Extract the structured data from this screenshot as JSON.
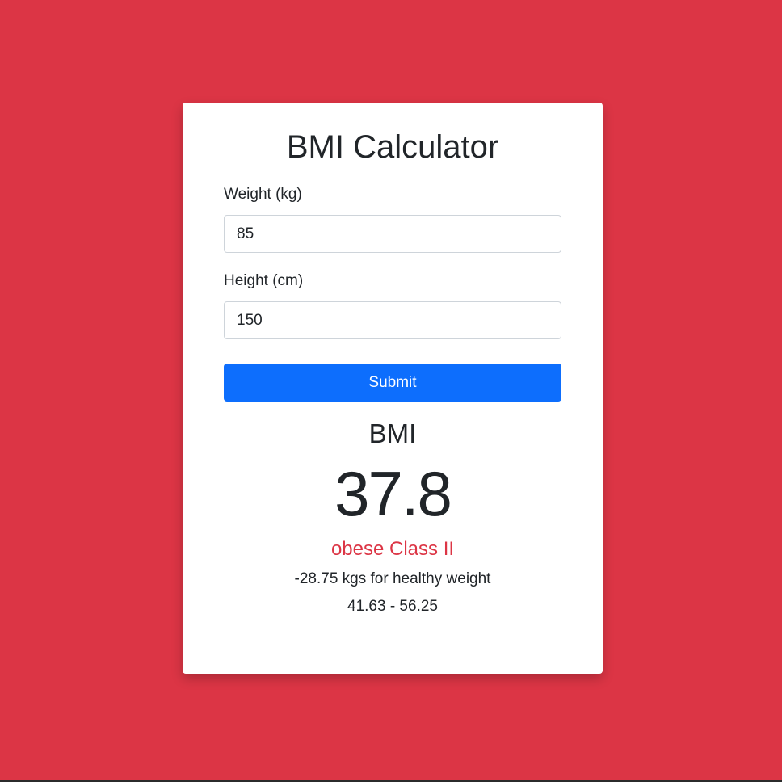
{
  "app": {
    "title": "BMI Calculator"
  },
  "form": {
    "weight_label": "Weight (kg)",
    "weight_value": "85",
    "height_label": "Height (cm)",
    "height_value": "150",
    "submit_label": "Submit"
  },
  "result": {
    "heading": "BMI",
    "value": "37.8",
    "classification": "obese Class II",
    "difference": "-28.75 kgs for healthy weight",
    "healthy_range": "41.63 - 56.25"
  },
  "colors": {
    "background": "#dc3545",
    "card": "#ffffff",
    "primary_button": "#0d6efd",
    "classification_text": "#dc3545"
  }
}
